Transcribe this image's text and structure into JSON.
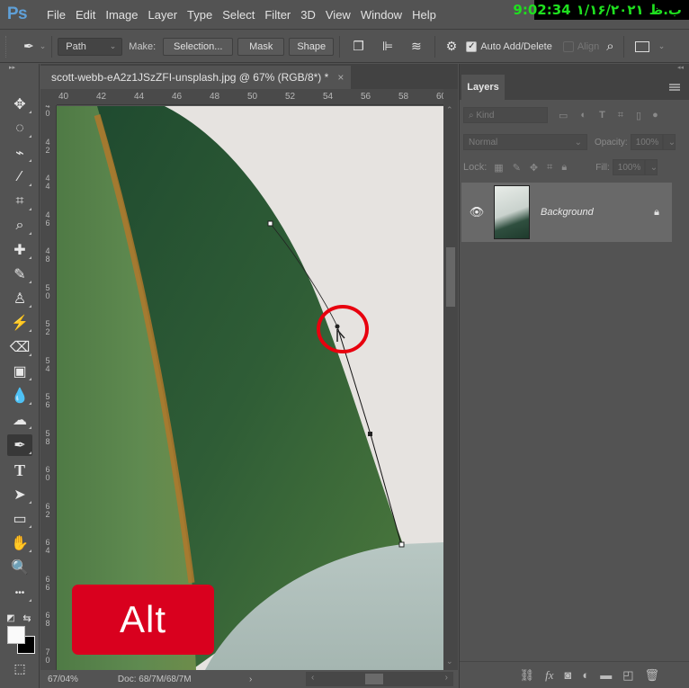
{
  "app": {
    "logo": "Ps",
    "menu": [
      "File",
      "Edit",
      "Image",
      "Layer",
      "Type",
      "Select",
      "Filter",
      "3D",
      "View",
      "Window",
      "Help"
    ],
    "clock": {
      "time": "9:02:34",
      "date": "۱/۱۶/۲۰۲۱",
      "suffix": "ب.ظ"
    }
  },
  "options_bar": {
    "tool_icon": "pen-tool-icon",
    "mode_value": "Path",
    "make_label": "Make:",
    "selection_btn": "Selection...",
    "mask_btn": "Mask",
    "shape_btn": "Shape",
    "auto_add_delete_label": "Auto Add/Delete",
    "auto_add_delete_checked": true,
    "align_label": "Align",
    "align_checked": false
  },
  "toolbar": {
    "tools": [
      {
        "name": "move-tool",
        "glyph": "✥"
      },
      {
        "name": "elliptical-marquee-tool",
        "glyph": "◌"
      },
      {
        "name": "lasso-tool",
        "glyph": "⌁"
      },
      {
        "name": "magic-wand-tool",
        "glyph": "⁄"
      },
      {
        "name": "crop-tool",
        "glyph": "⌗"
      },
      {
        "name": "eyedropper-tool",
        "glyph": "⌕"
      },
      {
        "name": "healing-brush-tool",
        "glyph": "✚"
      },
      {
        "name": "brush-tool",
        "glyph": "✎"
      },
      {
        "name": "clone-stamp-tool",
        "glyph": "♙"
      },
      {
        "name": "history-brush-tool",
        "glyph": "⚡"
      },
      {
        "name": "eraser-tool",
        "glyph": "⌫"
      },
      {
        "name": "gradient-tool",
        "glyph": "▣"
      },
      {
        "name": "blur-tool",
        "glyph": "💧"
      },
      {
        "name": "dodge-tool",
        "glyph": "☁"
      },
      {
        "name": "pen-tool",
        "glyph": "✒",
        "active": true
      },
      {
        "name": "type-tool",
        "glyph": "T"
      },
      {
        "name": "path-selection-tool",
        "glyph": "➤"
      },
      {
        "name": "rectangle-tool",
        "glyph": "▭"
      },
      {
        "name": "hand-tool",
        "glyph": "✋"
      },
      {
        "name": "zoom-tool",
        "glyph": "🔍"
      },
      {
        "name": "edit-toolbar",
        "glyph": "•••"
      }
    ],
    "foreground_color": "#fafafa",
    "background_color": "#000000",
    "quick_mask_glyph": "⬚"
  },
  "document": {
    "tab_title": "scott-webb-eA2z1JSzZFI-unsplash.jpg @ 67% (RGB/8*) *",
    "close_glyph": "×",
    "ruler_h": [
      "40",
      "42",
      "44",
      "46",
      "48",
      "50",
      "52",
      "54",
      "56",
      "58",
      "60"
    ],
    "ruler_v": [
      "40",
      "42",
      "44",
      "46",
      "48",
      "50",
      "52",
      "54",
      "56",
      "58",
      "60",
      "62",
      "64",
      "66",
      "68",
      "70"
    ],
    "status_zoom": "67/04%",
    "status_doc": "Doc: 68/7M/68/7M",
    "keyboard_badge": "Alt"
  },
  "layers_panel": {
    "tab": "Layers",
    "filter_kind": "Kind",
    "blend_mode": "Normal",
    "opacity_label": "Opacity:",
    "opacity_value": "100%",
    "lock_label": "Lock:",
    "fill_label": "Fill:",
    "fill_value": "100%",
    "layers": [
      {
        "name": "Background",
        "visible": true,
        "locked": true
      }
    ]
  },
  "colors": {
    "accent_red": "#d9001e",
    "clock_green": "#1fe01f",
    "leaf_green": "#3b6b3a",
    "ui_gray": "#535353"
  }
}
